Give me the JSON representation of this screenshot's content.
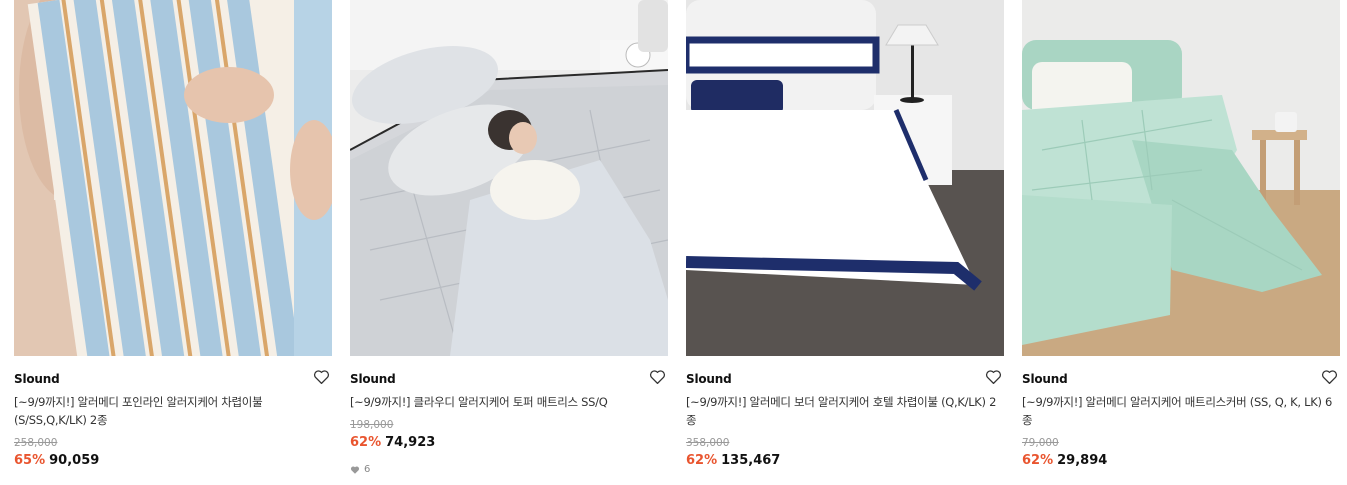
{
  "products": [
    {
      "brand": "Slound",
      "title": "[~9/9까지!] 알러메디 포인라인 알러지케어 차렵이불 (S/SS,Q,K/LK) 2종",
      "original_price": "258,000",
      "discount": "65%",
      "price": "90,059",
      "image_icon": "striped-comforter-photo",
      "heart_icon": "heart-outline-icon"
    },
    {
      "brand": "Slound",
      "title": "[~9/9까지!] 클라우디 알러지케어 토퍼 매트리스 SS/Q",
      "original_price": "198,000",
      "discount": "62%",
      "price": "74,923",
      "likes": "6",
      "image_icon": "topper-mattress-photo",
      "heart_icon": "heart-outline-icon"
    },
    {
      "brand": "Slound",
      "title": "[~9/9까지!] 알러메디 보더 알러지케어 호텔 차렵이불 (Q,K/LK) 2종",
      "original_price": "358,000",
      "discount": "62%",
      "price": "135,467",
      "image_icon": "hotel-bedding-photo",
      "heart_icon": "heart-outline-icon"
    },
    {
      "brand": "Slound",
      "title": "[~9/9까지!] 알러메디 알러지케어 매트리스커버 (SS, Q, K, LK) 6종",
      "original_price": "79,000",
      "discount": "62%",
      "price": "29,894",
      "image_icon": "mint-mattress-cover-photo",
      "heart_icon": "heart-outline-icon"
    }
  ],
  "colors": {
    "discount": "#e9552f",
    "brand_text": "#111111",
    "muted": "#999999"
  }
}
